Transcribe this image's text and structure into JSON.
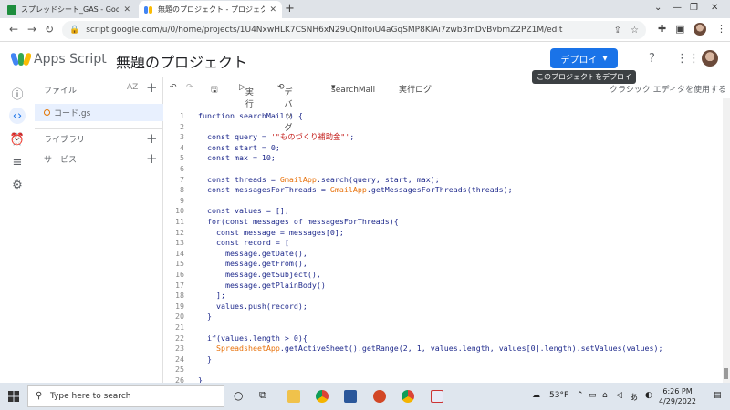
{
  "browser": {
    "tabs": [
      {
        "title": "スプレッドシート_GAS - Google スプレ",
        "active": false,
        "favicon": "sheets-icon"
      },
      {
        "title": "無題のプロジェクト - プロジェクト編集",
        "active": true,
        "favicon": "apps-script-icon"
      }
    ],
    "url": "script.google.com/u/0/home/projects/1U4NxwHLK7CSNH6xN29uQnIfoiU4aGqSMP8KlAi7zwb3mDvBvbmZ2PZ1M/edit"
  },
  "header": {
    "brand": "Apps Script",
    "project_title": "無題のプロジェクト",
    "deploy_label": "デプロイ",
    "deploy_tooltip": "このプロジェクトをデプロイ"
  },
  "files_panel": {
    "title": "ファイル",
    "sort_label": "AZ",
    "file": "コード.gs",
    "sections": [
      "ライブラリ",
      "サービス"
    ]
  },
  "editor_toolbar": {
    "run": "実行",
    "debug": "デバッグ",
    "function_select": "searchMail",
    "log": "実行ログ",
    "classic": "クラシック エディタを使用する"
  },
  "code_lines": [
    "function searchMail() {",
    "",
    "  const query = '\"ものづくり補助金\"';",
    "  const start = 0;",
    "  const max = 10;",
    "",
    "  const threads = GmailApp.search(query, start, max);",
    "  const messagesForThreads = GmailApp.getMessagesForThreads(threads);",
    "",
    "  const values = [];",
    "  for(const messages of messagesForThreads){",
    "    const message = messages[0];",
    "    const record = [",
    "      message.getDate(),",
    "      message.getFrom(),",
    "      message.getSubject(),",
    "      message.getPlainBody()",
    "    ];",
    "    values.push(record);",
    "  }",
    "",
    "  if(values.length > 0){",
    "    SpreadsheetApp.getActiveSheet().getRange(2, 1, values.length, values[0].length).setValues(values);",
    "  }",
    "",
    "}"
  ],
  "taskbar": {
    "search_placeholder": "Type here to search",
    "temperature": "53°F",
    "ime": "あ",
    "time": "6:26 PM",
    "date": "4/29/2022"
  }
}
